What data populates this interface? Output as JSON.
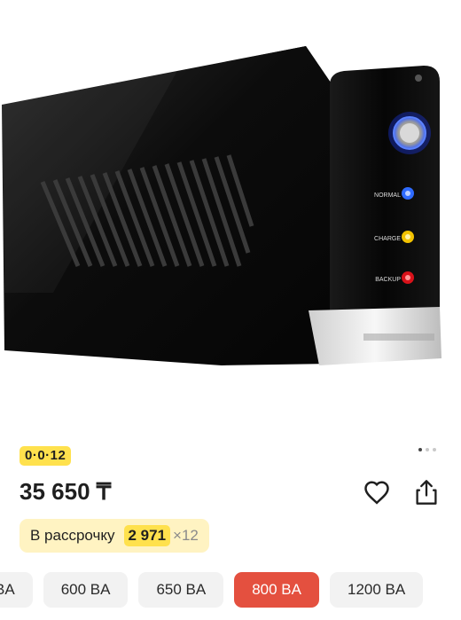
{
  "product": {
    "image_alt": "UPS unit",
    "device_labels": {
      "normal": "NORMAL",
      "charge": "CHARGE",
      "backup": "BACKUP"
    },
    "badge": "0·0·12",
    "price": "35 650 ₸",
    "installment": {
      "label": "В рассрочку",
      "amount": "2 971",
      "multiplier": "×12"
    }
  },
  "gallery": {
    "total": 3,
    "active": 1
  },
  "variants": [
    {
      "label": "BA",
      "selected": false
    },
    {
      "label": "600 BA",
      "selected": false
    },
    {
      "label": "650 BA",
      "selected": false
    },
    {
      "label": "800 BA",
      "selected": true
    },
    {
      "label": "1200 BA",
      "selected": false
    }
  ],
  "colors": {
    "badge_yellow": "#ffe14d",
    "installment_bg": "#fff3c2",
    "selected_variant": "#e4503f"
  },
  "icons": {
    "favorite": "heart-icon",
    "share": "share-icon"
  }
}
